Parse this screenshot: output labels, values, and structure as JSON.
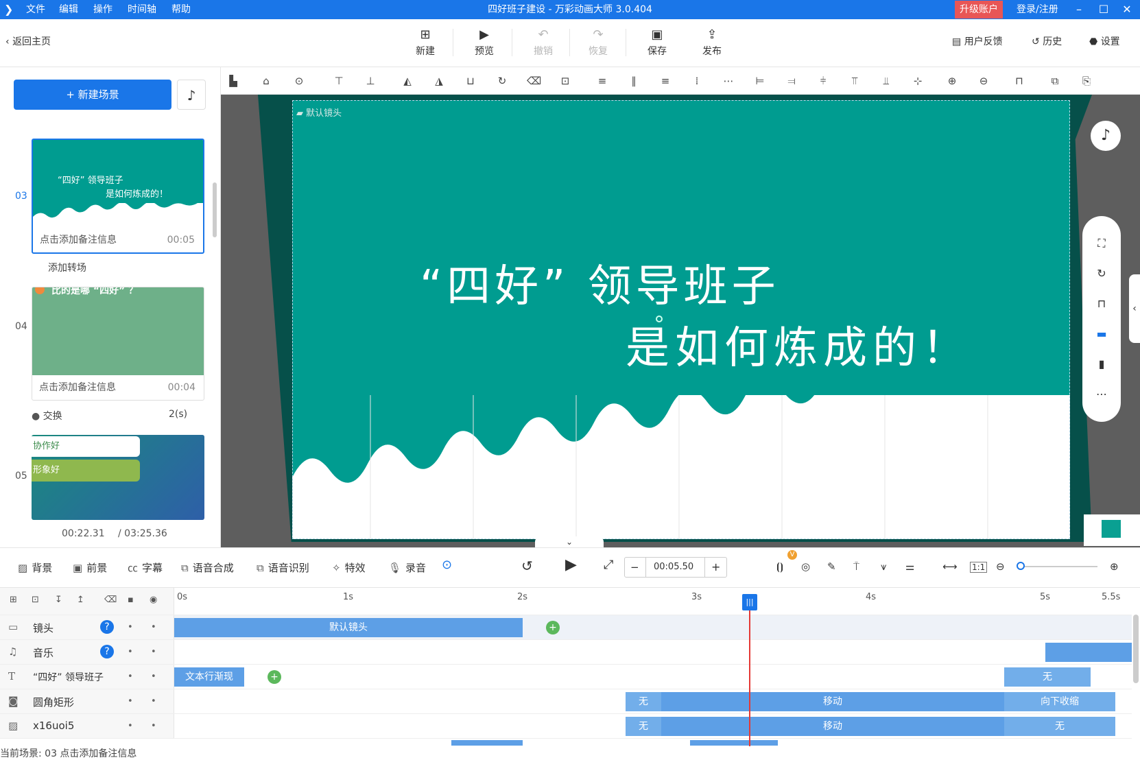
{
  "titlebar": {
    "menu": [
      "文件",
      "编辑",
      "操作",
      "时间轴",
      "帮助"
    ],
    "title": "四好班子建设 - 万彩动画大师 3.0.404",
    "upgrade": "升级账户",
    "login": "登录/注册",
    "win_min": "–",
    "win_max": "☐",
    "win_close": "✕"
  },
  "toolbar": {
    "back": "返回主页",
    "new": "新建",
    "preview": "预览",
    "undo": "撤销",
    "redo": "恢复",
    "save": "保存",
    "publish": "发布",
    "feedback": "用户反馈",
    "history": "历史",
    "settings": "设置"
  },
  "left": {
    "new_scene": "+ 新建场景",
    "scenes": [
      {
        "num": "03",
        "note": "点击添加备注信息",
        "duration": "00:05",
        "thumb_line1": "“四好” 领导班子",
        "thumb_line2": "是如何炼成的！"
      },
      {
        "num": "04",
        "note": "点击添加备注信息",
        "duration": "00:04",
        "thumb_text": "比的是哪  “四好” ？"
      },
      {
        "num": "05",
        "thumb_tag1": "协作好",
        "thumb_tag2": "形象好"
      }
    ],
    "add_transition": "添加转场",
    "transition_name": "交换",
    "transition_dur": "2(s)",
    "time_current": "00:22.31",
    "time_total": "/ 03:25.36"
  },
  "canvas": {
    "camera_label": "默认镜头",
    "title_line1": "“四好” 领导班子",
    "title_line2": "是如何炼成的！",
    "bg_color": "#009c90"
  },
  "bottom": {
    "tools": [
      "背景",
      "前景",
      "字幕",
      "语音合成",
      "语音识别",
      "特效",
      "录音"
    ],
    "timecode": "00:05.50",
    "minus": "−",
    "plus": "+",
    "ratio": "1:1"
  },
  "ruler": [
    "0s",
    "1s",
    "2s",
    "3s",
    "4s",
    "5s",
    "5.5s"
  ],
  "tracks": [
    {
      "name": "镜头",
      "blocks": [
        {
          "text": "默认镜头"
        }
      ]
    },
    {
      "name": "音乐",
      "blocks": []
    },
    {
      "name": "“四好” 领导班子",
      "blocks": [
        {
          "text": "文本行渐现"
        },
        {
          "text": "无"
        }
      ]
    },
    {
      "name": "圆角矩形",
      "blocks": [
        {
          "text": "无"
        },
        {
          "text": "移动"
        },
        {
          "text": "向下收缩"
        }
      ]
    },
    {
      "name": "x16uoi5",
      "blocks": [
        {
          "text": "无"
        },
        {
          "text": "移动"
        },
        {
          "text": "无"
        }
      ]
    }
  ],
  "status": "当前场景: 03    点击添加备注信息",
  "colors": {
    "accent": "#1a76e8",
    "stage": "#009c90",
    "block": "#5d9fe6"
  }
}
